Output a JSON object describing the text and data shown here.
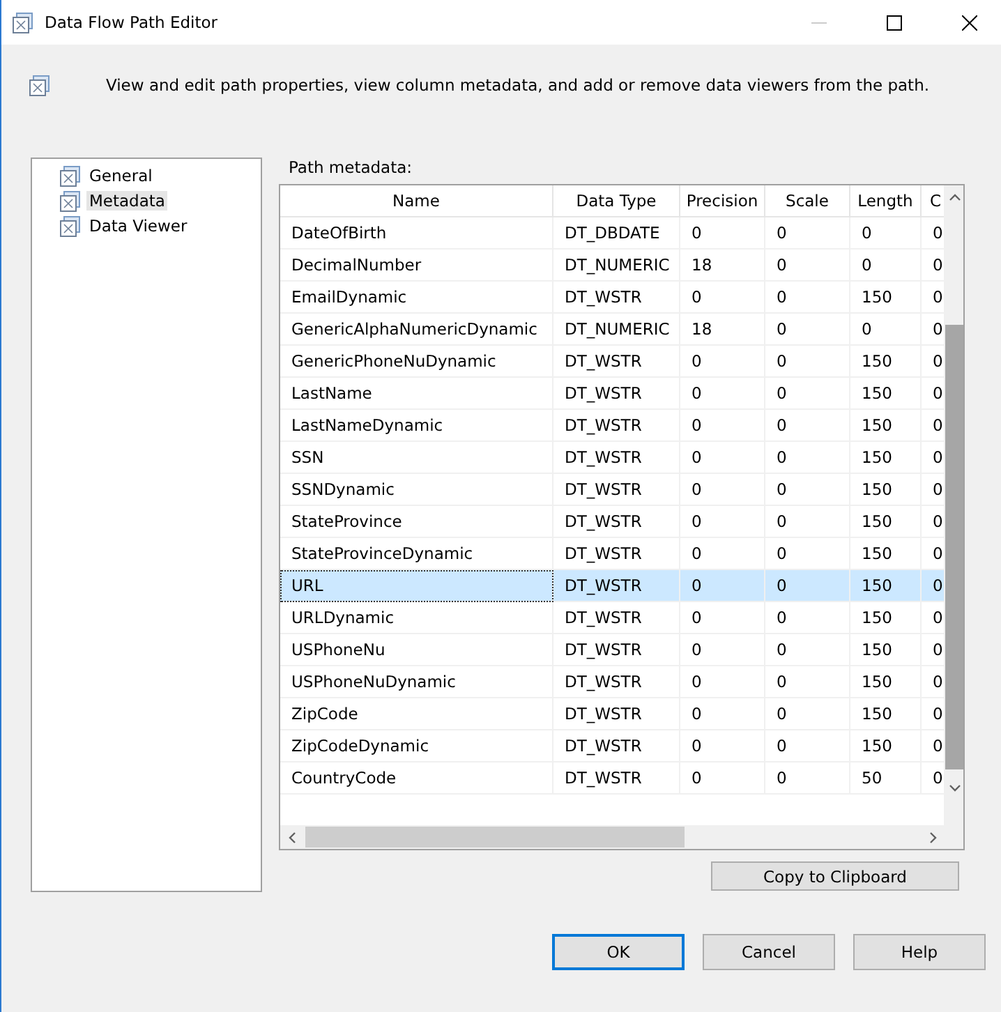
{
  "window": {
    "title": "Data Flow Path Editor"
  },
  "header": {
    "description": "View and edit path properties, view column metadata, and add or remove data viewers from the path."
  },
  "sidebar": {
    "items": [
      {
        "label": "General",
        "selected": false
      },
      {
        "label": "Metadata",
        "selected": true
      },
      {
        "label": "Data Viewer",
        "selected": false
      }
    ]
  },
  "metadata": {
    "label": "Path metadata:",
    "columns": [
      "Name",
      "Data Type",
      "Precision",
      "Scale",
      "Length",
      "C"
    ],
    "rows": [
      {
        "cells": [
          "DateOfBirth",
          "DT_DBDATE",
          "0",
          "0",
          "0",
          "0"
        ],
        "selected": false
      },
      {
        "cells": [
          "DecimalNumber",
          "DT_NUMERIC",
          "18",
          "0",
          "0",
          "0"
        ],
        "selected": false
      },
      {
        "cells": [
          "EmailDynamic",
          "DT_WSTR",
          "0",
          "0",
          "150",
          "0"
        ],
        "selected": false
      },
      {
        "cells": [
          "GenericAlphaNumericDynamic",
          "DT_NUMERIC",
          "18",
          "0",
          "0",
          "0"
        ],
        "selected": false
      },
      {
        "cells": [
          "GenericPhoneNuDynamic",
          "DT_WSTR",
          "0",
          "0",
          "150",
          "0"
        ],
        "selected": false
      },
      {
        "cells": [
          "LastName",
          "DT_WSTR",
          "0",
          "0",
          "150",
          "0"
        ],
        "selected": false
      },
      {
        "cells": [
          "LastNameDynamic",
          "DT_WSTR",
          "0",
          "0",
          "150",
          "0"
        ],
        "selected": false
      },
      {
        "cells": [
          "SSN",
          "DT_WSTR",
          "0",
          "0",
          "150",
          "0"
        ],
        "selected": false
      },
      {
        "cells": [
          "SSNDynamic",
          "DT_WSTR",
          "0",
          "0",
          "150",
          "0"
        ],
        "selected": false
      },
      {
        "cells": [
          "StateProvince",
          "DT_WSTR",
          "0",
          "0",
          "150",
          "0"
        ],
        "selected": false
      },
      {
        "cells": [
          "StateProvinceDynamic",
          "DT_WSTR",
          "0",
          "0",
          "150",
          "0"
        ],
        "selected": false
      },
      {
        "cells": [
          "URL",
          "DT_WSTR",
          "0",
          "0",
          "150",
          "0"
        ],
        "selected": true
      },
      {
        "cells": [
          "URLDynamic",
          "DT_WSTR",
          "0",
          "0",
          "150",
          "0"
        ],
        "selected": false
      },
      {
        "cells": [
          "USPhoneNu",
          "DT_WSTR",
          "0",
          "0",
          "150",
          "0"
        ],
        "selected": false
      },
      {
        "cells": [
          "USPhoneNuDynamic",
          "DT_WSTR",
          "0",
          "0",
          "150",
          "0"
        ],
        "selected": false
      },
      {
        "cells": [
          "ZipCode",
          "DT_WSTR",
          "0",
          "0",
          "150",
          "0"
        ],
        "selected": false
      },
      {
        "cells": [
          "ZipCodeDynamic",
          "DT_WSTR",
          "0",
          "0",
          "150",
          "0"
        ],
        "selected": false
      },
      {
        "cells": [
          "CountryCode",
          "DT_WSTR",
          "0",
          "0",
          "50",
          "0"
        ],
        "selected": false
      }
    ],
    "copy_button": "Copy to Clipboard"
  },
  "buttons": [
    {
      "label": "OK",
      "default": true
    },
    {
      "label": "Cancel",
      "default": false
    },
    {
      "label": "Help",
      "default": false
    }
  ]
}
